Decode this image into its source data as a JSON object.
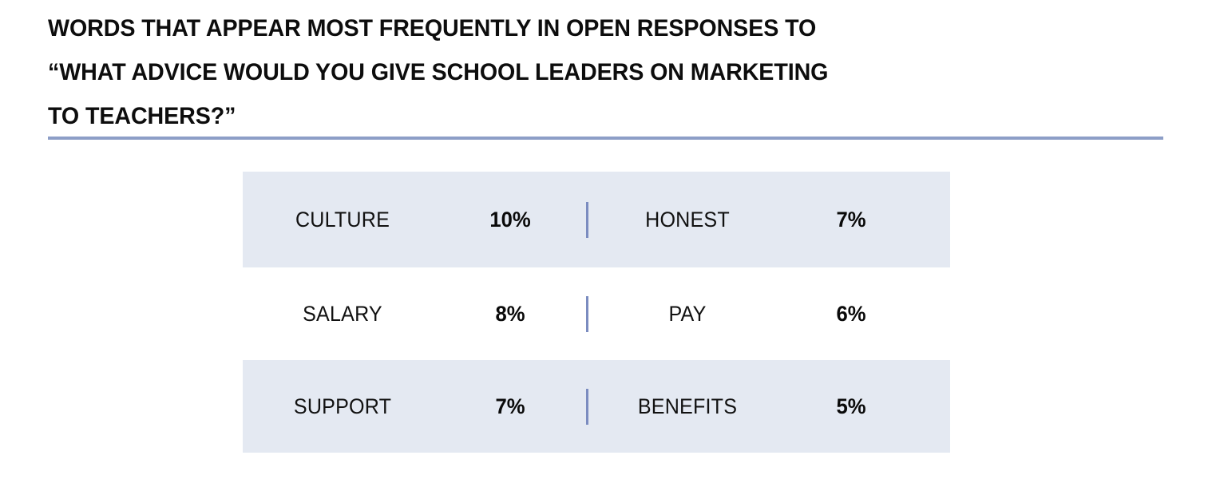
{
  "header": {
    "title": "WORDS THAT APPEAR MOST FREQUENTLY IN OPEN RESPONSES TO\n“WHAT ADVICE WOULD YOU GIVE SCHOOL LEADERS ON MARKETING\nTO TEACHERS?”",
    "rule_color": "#8d9ec7"
  },
  "table": {
    "shade_color": "#e4e9f2",
    "divider_color": "#7b8cc0",
    "rows": [
      {
        "shaded": true,
        "left": {
          "word": "CULTURE",
          "percent": "10%"
        },
        "right": {
          "word": "HONEST",
          "percent": "7%"
        }
      },
      {
        "shaded": false,
        "left": {
          "word": "SALARY",
          "percent": "8%"
        },
        "right": {
          "word": "PAY",
          "percent": "6%"
        }
      },
      {
        "shaded": true,
        "left": {
          "word": "SUPPORT",
          "percent": "7%"
        },
        "right": {
          "word": "BENEFITS",
          "percent": "5%"
        }
      }
    ]
  },
  "chart_data": {
    "type": "table",
    "title": "WORDS THAT APPEAR MOST FREQUENTLY IN OPEN RESPONSES TO “WHAT ADVICE WOULD YOU GIVE SCHOOL LEADERS ON MARKETING TO TEACHERS?”",
    "xlabel": "",
    "ylabel": "",
    "categories": [
      "CULTURE",
      "SALARY",
      "SUPPORT",
      "HONEST",
      "PAY",
      "BENEFITS"
    ],
    "values": [
      10,
      8,
      7,
      7,
      6,
      5
    ],
    "value_labels": [
      "10%",
      "8%",
      "7%",
      "7%",
      "6%",
      "5%"
    ],
    "unit": "percent",
    "layout": "two-column-list",
    "columns": [
      {
        "words": [
          "CULTURE",
          "SALARY",
          "SUPPORT"
        ],
        "values": [
          10,
          8,
          7
        ]
      },
      {
        "words": [
          "HONEST",
          "PAY",
          "BENEFITS"
        ],
        "values": [
          7,
          6,
          5
        ]
      }
    ],
    "grid": false,
    "legend": "none"
  }
}
